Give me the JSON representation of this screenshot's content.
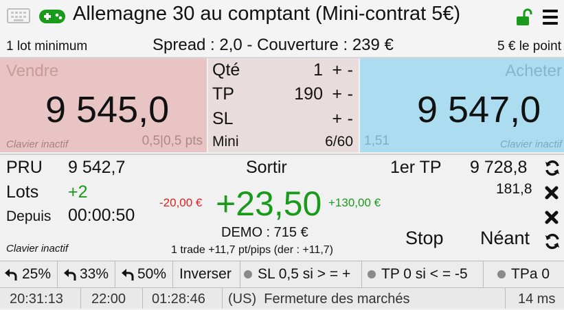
{
  "header": {
    "title": "Allemagne 30 au comptant (Mini-contrat 5€)",
    "icons": [
      "keyboard-icon",
      "gamepad-icon",
      "unlock-icon",
      "menu-icon"
    ],
    "gamepad_color": "#1a9a1a",
    "lock_color": "#1a9a1a"
  },
  "info": {
    "min_lot": "1 lot minimum",
    "spread": "Spread : 2,0 - Couverture : 239 €",
    "point_value": "5 € le point"
  },
  "sell": {
    "label": "Vendre",
    "price": "9 545,0",
    "keyboard": "Clavier inactif",
    "spread_pts": "0,5|0,5 pts",
    "bg": "#e8c4c4"
  },
  "buy": {
    "label": "Acheter",
    "price": "9 547,0",
    "keyboard": "Clavier inactif",
    "value": "1,51",
    "bg": "#abdcf0"
  },
  "order": {
    "qty_label": "Qté",
    "qty_value": "1",
    "tp_label": "TP",
    "tp_value": "190",
    "sl_label": "SL",
    "sl_value": "",
    "mini_label": "Mini",
    "mini_value": "6/60",
    "plus": "+",
    "minus": "-"
  },
  "position": {
    "pru_label": "PRU",
    "pru_value": "9 542,7",
    "lots_label": "Lots",
    "lots_value": "+2",
    "since_label": "Depuis",
    "since_value": "00:00:50",
    "keyboard": "Clavier inactif",
    "exit_label": "Sortir",
    "pnl_low": "-20,00 €",
    "pnl": "+23,50",
    "pnl_high": "+130,00 €",
    "demo": "DEMO : 715 €",
    "trade_summary": "1 trade +11,7 pt/pips (der : +11,7)",
    "first_tp_label": "1er TP",
    "first_tp_value": "9 728,8",
    "first_tp_distance": "181,8",
    "stop_label": "Stop",
    "stop_value": "Néant"
  },
  "buttons": {
    "close25": "25%",
    "close33": "33%",
    "close50": "50%",
    "invert": "Inverser",
    "sl_rule": "SL 0,5 si > = +",
    "tp_rule": "TP 0 si < = -5",
    "tpa": "TPa 0"
  },
  "status": {
    "time": "20:31:13",
    "close_time": "22:00",
    "countdown": "01:28:46",
    "market": "(US)",
    "market_status": "Fermeture des marchés",
    "latency": "14 ms"
  }
}
